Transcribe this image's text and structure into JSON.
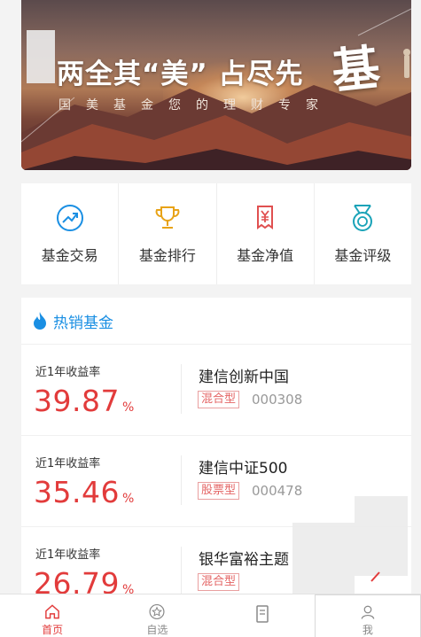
{
  "banner": {
    "headline": "两全其“美” 占尽先",
    "brush_char": "基",
    "subtitle": "国美基金您的理财专家"
  },
  "quick_menu": [
    {
      "label": "基金交易",
      "icon": "trend-arrow-icon"
    },
    {
      "label": "基金排行",
      "icon": "trophy-icon"
    },
    {
      "label": "基金净值",
      "icon": "yen-document-icon"
    },
    {
      "label": "基金评级",
      "icon": "medal-icon"
    }
  ],
  "hot_funds": {
    "title": "热销基金",
    "items": [
      {
        "rate_label": "近1年收益率",
        "rate": "39.87",
        "unit": "%",
        "name": "建信创新中国",
        "type": "混合型",
        "code": "000308"
      },
      {
        "rate_label": "近1年收益率",
        "rate": "35.46",
        "unit": "%",
        "name": "建信中证500",
        "type": "股票型",
        "code": "000478"
      },
      {
        "rate_label": "近1年收益率",
        "rate": "26.79",
        "unit": "%",
        "name": "银华富裕主题",
        "type": "混合型",
        "code": ""
      }
    ]
  },
  "tabbar": [
    {
      "label": "首页",
      "icon": "home-icon",
      "active": true
    },
    {
      "label": "自选",
      "icon": "star-icon",
      "active": false
    },
    {
      "label": "",
      "icon": "document-icon",
      "active": false
    },
    {
      "label": "我",
      "icon": "user-icon",
      "active": false
    }
  ],
  "colors": {
    "accent_red": "#e23b3b",
    "accent_blue": "#1a8fe3"
  }
}
